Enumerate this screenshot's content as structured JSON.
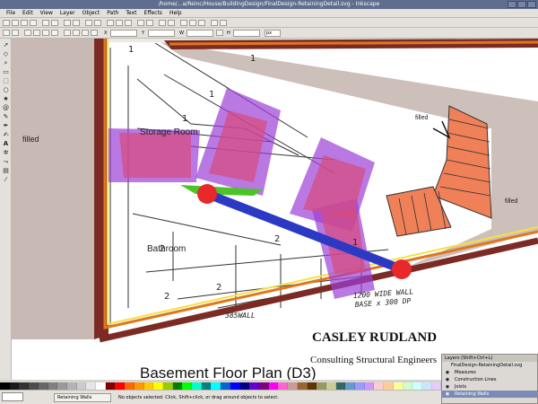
{
  "window": {
    "title": "/home/...a/Reinc/House/BuildingDesign/FinalDesign-RetainingDetail.svg - Inkscape"
  },
  "menu": [
    "File",
    "Edit",
    "View",
    "Layer",
    "Object",
    "Path",
    "Text",
    "Effects",
    "Help"
  ],
  "toolbar": {
    "x_label": "X",
    "y_label": "Y",
    "w_label": "W",
    "h_label": "H",
    "unit": "px"
  },
  "canvas": {
    "room_labels": {
      "storage": "Storage Room",
      "bathroom": "Bathroom"
    },
    "filled_labels": [
      "filled",
      "filled",
      "filled"
    ],
    "handwriting": {
      "wall_note_line1": "1200 WIDE WALL",
      "wall_note_line2": "BASE x 300 DP",
      "wall_size": "385WALL"
    },
    "title_block": {
      "company": "CASLEY RUDLAND",
      "subtitle": "Consulting Structural Engineers",
      "plan_title": "Basement  Floor Plan (D3)"
    },
    "dim_marks": [
      "1",
      "1",
      "1",
      "2",
      "2",
      "2",
      "1",
      "1",
      "2"
    ]
  },
  "layers_panel": {
    "title": "Layers (Shift+Ctrl+L)",
    "root": "FinalDesign-RetainingDetail.svg",
    "layers": [
      "Measures",
      "Construction Lines",
      "Joists",
      "Retaining Walls",
      "..."
    ],
    "selected_index": 3
  },
  "status": {
    "current_layer": "Retaining Walls",
    "message": "No objects selected. Click, Shift+click, or drag around objects to select."
  },
  "palette": [
    "#000000",
    "#1a1a1a",
    "#333333",
    "#4d4d4d",
    "#666666",
    "#808080",
    "#999999",
    "#b3b3b3",
    "#cccccc",
    "#e6e6e6",
    "#ffffff",
    "#800000",
    "#ff0000",
    "#ff6600",
    "#ff9900",
    "#ffcc00",
    "#ffff00",
    "#99cc00",
    "#008000",
    "#00ff00",
    "#00ffcc",
    "#008080",
    "#00ffff",
    "#0066cc",
    "#0000ff",
    "#000080",
    "#6600cc",
    "#800080",
    "#ff00ff",
    "#ff66cc",
    "#cc9999",
    "#996633",
    "#663300",
    "#999966",
    "#cccc99",
    "#336666",
    "#6699cc",
    "#9999ff",
    "#cc99ff",
    "#ffcccc",
    "#ffcc99",
    "#ffff99",
    "#ccffcc",
    "#ccffff",
    "#cce5ff",
    "#e5ccff"
  ]
}
